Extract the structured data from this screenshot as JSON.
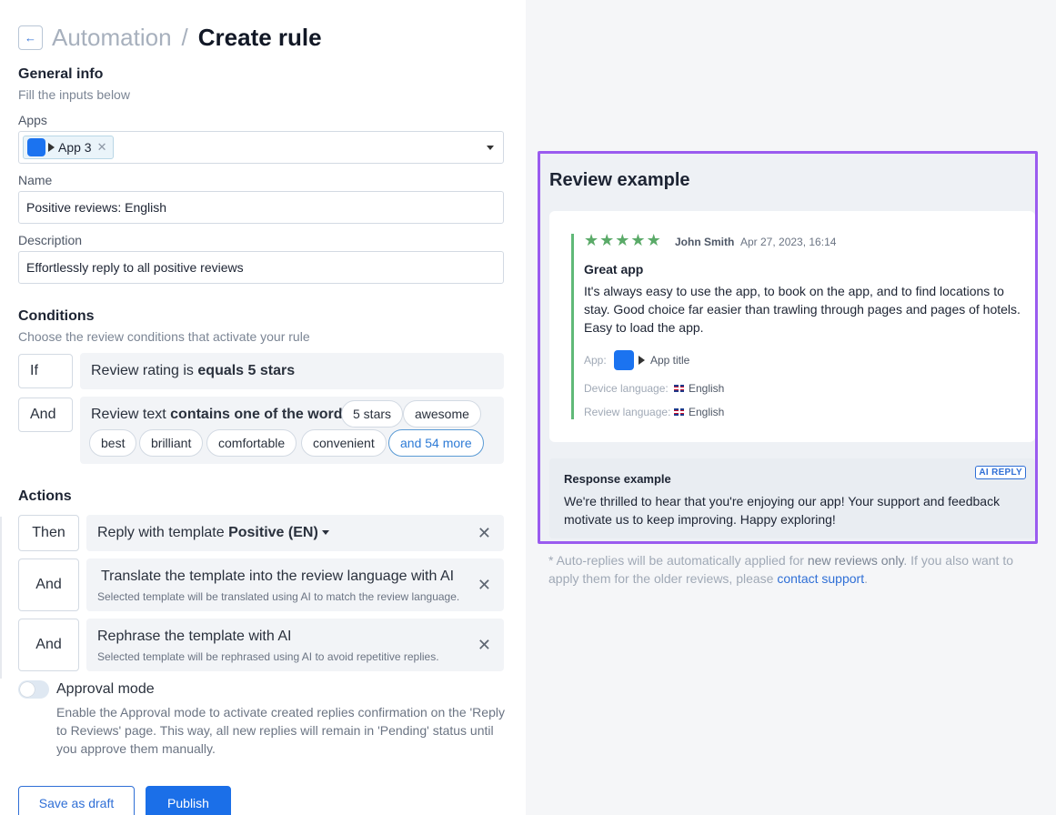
{
  "header": {
    "back_icon": "arrow-left-icon",
    "breadcrumb_parent": "Automation",
    "separator": "/",
    "title": "Create rule"
  },
  "general": {
    "title": "General info",
    "subtitle": "Fill the inputs below",
    "apps_label": "Apps",
    "apps_selected": "App 3",
    "name_label": "Name",
    "name_value": "Positive reviews: English",
    "description_label": "Description",
    "description_value": "Effortlessly reply to all positive reviews"
  },
  "conditions": {
    "title": "Conditions",
    "subtitle": "Choose the review conditions that activate your rule",
    "if_key": "If",
    "if_prefix": "Review rating is",
    "if_value": "equals 5 stars",
    "and_key": "And",
    "and_prefix": "Review text",
    "and_value": "contains one of the words",
    "words": [
      "5 stars",
      "awesome",
      "best",
      "brilliant",
      "comfortable",
      "convenient"
    ],
    "more": "and 54 more"
  },
  "actions": {
    "title": "Actions",
    "items": [
      {
        "key": "Then",
        "prefix": "Reply with template",
        "value": "Positive (EN)",
        "subtitle": ""
      },
      {
        "key": "And",
        "prefix": "Translate the template into the review language with AI",
        "value": "",
        "subtitle": "Selected template will be translated using AI to match the review language."
      },
      {
        "key": "And",
        "prefix": "Rephrase the template with AI",
        "value": "",
        "subtitle": "Selected template will be rephrased using AI to avoid repetitive replies."
      }
    ],
    "close_symbol": "✕"
  },
  "approval": {
    "title": "Approval mode",
    "enabled": false,
    "description": "Enable the Approval mode to activate created replies confirmation on the 'Reply to Reviews' page. This way, all new replies will remain in 'Pending' status until you approve them manually."
  },
  "buttons": {
    "draft": "Save as draft",
    "publish": "Publish"
  },
  "preview": {
    "title": "Review example",
    "stars": 5,
    "reviewer": "John Smith",
    "date": "Apr 27, 2023, 16:14",
    "review_title": "Great app",
    "review_body": "It's always easy to use the app, to book on the app, and to find locations to stay. Good choice far easier than trawling through pages and pages of hotels. Easy to load the app.",
    "app_label": "App:",
    "app_value": "App title",
    "device_lang_label": "Device language:",
    "device_lang_value": "English",
    "review_lang_label": "Review language:",
    "review_lang_value": "English",
    "response_title": "Response example",
    "ai_badge": "AI REPLY",
    "response_body": "We're thrilled to hear that you're enjoying our app!  Your support and feedback motivate us to keep improving. Happy exploring!"
  },
  "note": {
    "prefix": "* Auto-replies will be automatically applied for",
    "highlight": "new reviews only",
    "middle": ". If you also want to apply them for the older reviews, please",
    "link": "contact support",
    "suffix": "."
  },
  "colors": {
    "accent": "#1b6fe8",
    "preview_border": "#9a5bef",
    "stars": "#5aaa68",
    "right_bg": "#f5f6f8"
  }
}
